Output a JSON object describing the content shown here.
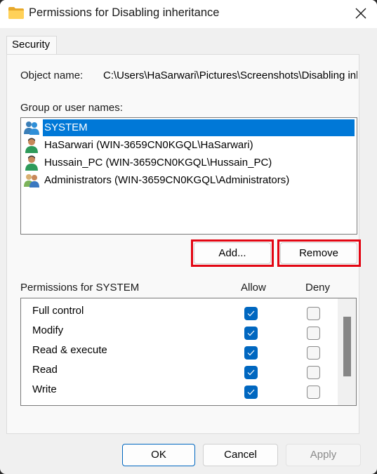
{
  "window": {
    "title": "Permissions for Disabling inheritance",
    "icon": "folder-icon",
    "close_icon": "close-icon"
  },
  "tabs": [
    {
      "label": "Security",
      "active": true
    }
  ],
  "object": {
    "label": "Object name:",
    "value": "C:\\Users\\HaSarwari\\Pictures\\Screenshots\\Disabling inheritance"
  },
  "groups": {
    "label": "Group or user names:",
    "items": [
      {
        "name": "SYSTEM",
        "icon": "group-icon",
        "selected": true
      },
      {
        "name": "HaSarwari (WIN-3659CN0KGQL\\HaSarwari)",
        "icon": "user-icon",
        "selected": false
      },
      {
        "name": "Hussain_PC (WIN-3659CN0KGQL\\Hussain_PC)",
        "icon": "user-icon",
        "selected": false
      },
      {
        "name": "Administrators (WIN-3659CN0KGQL\\Administrators)",
        "icon": "admin-group-icon",
        "selected": false
      }
    ]
  },
  "buttons": {
    "add": "Add...",
    "remove": "Remove",
    "ok": "OK",
    "cancel": "Cancel",
    "apply": "Apply"
  },
  "highlight_color": "#e30613",
  "permissions": {
    "label": "Permissions for SYSTEM",
    "allow_header": "Allow",
    "deny_header": "Deny",
    "rows": [
      {
        "name": "Full control",
        "allow": true,
        "deny": false
      },
      {
        "name": "Modify",
        "allow": true,
        "deny": false
      },
      {
        "name": "Read & execute",
        "allow": true,
        "deny": false
      },
      {
        "name": "Read",
        "allow": true,
        "deny": false
      },
      {
        "name": "Write",
        "allow": true,
        "deny": false
      }
    ]
  }
}
